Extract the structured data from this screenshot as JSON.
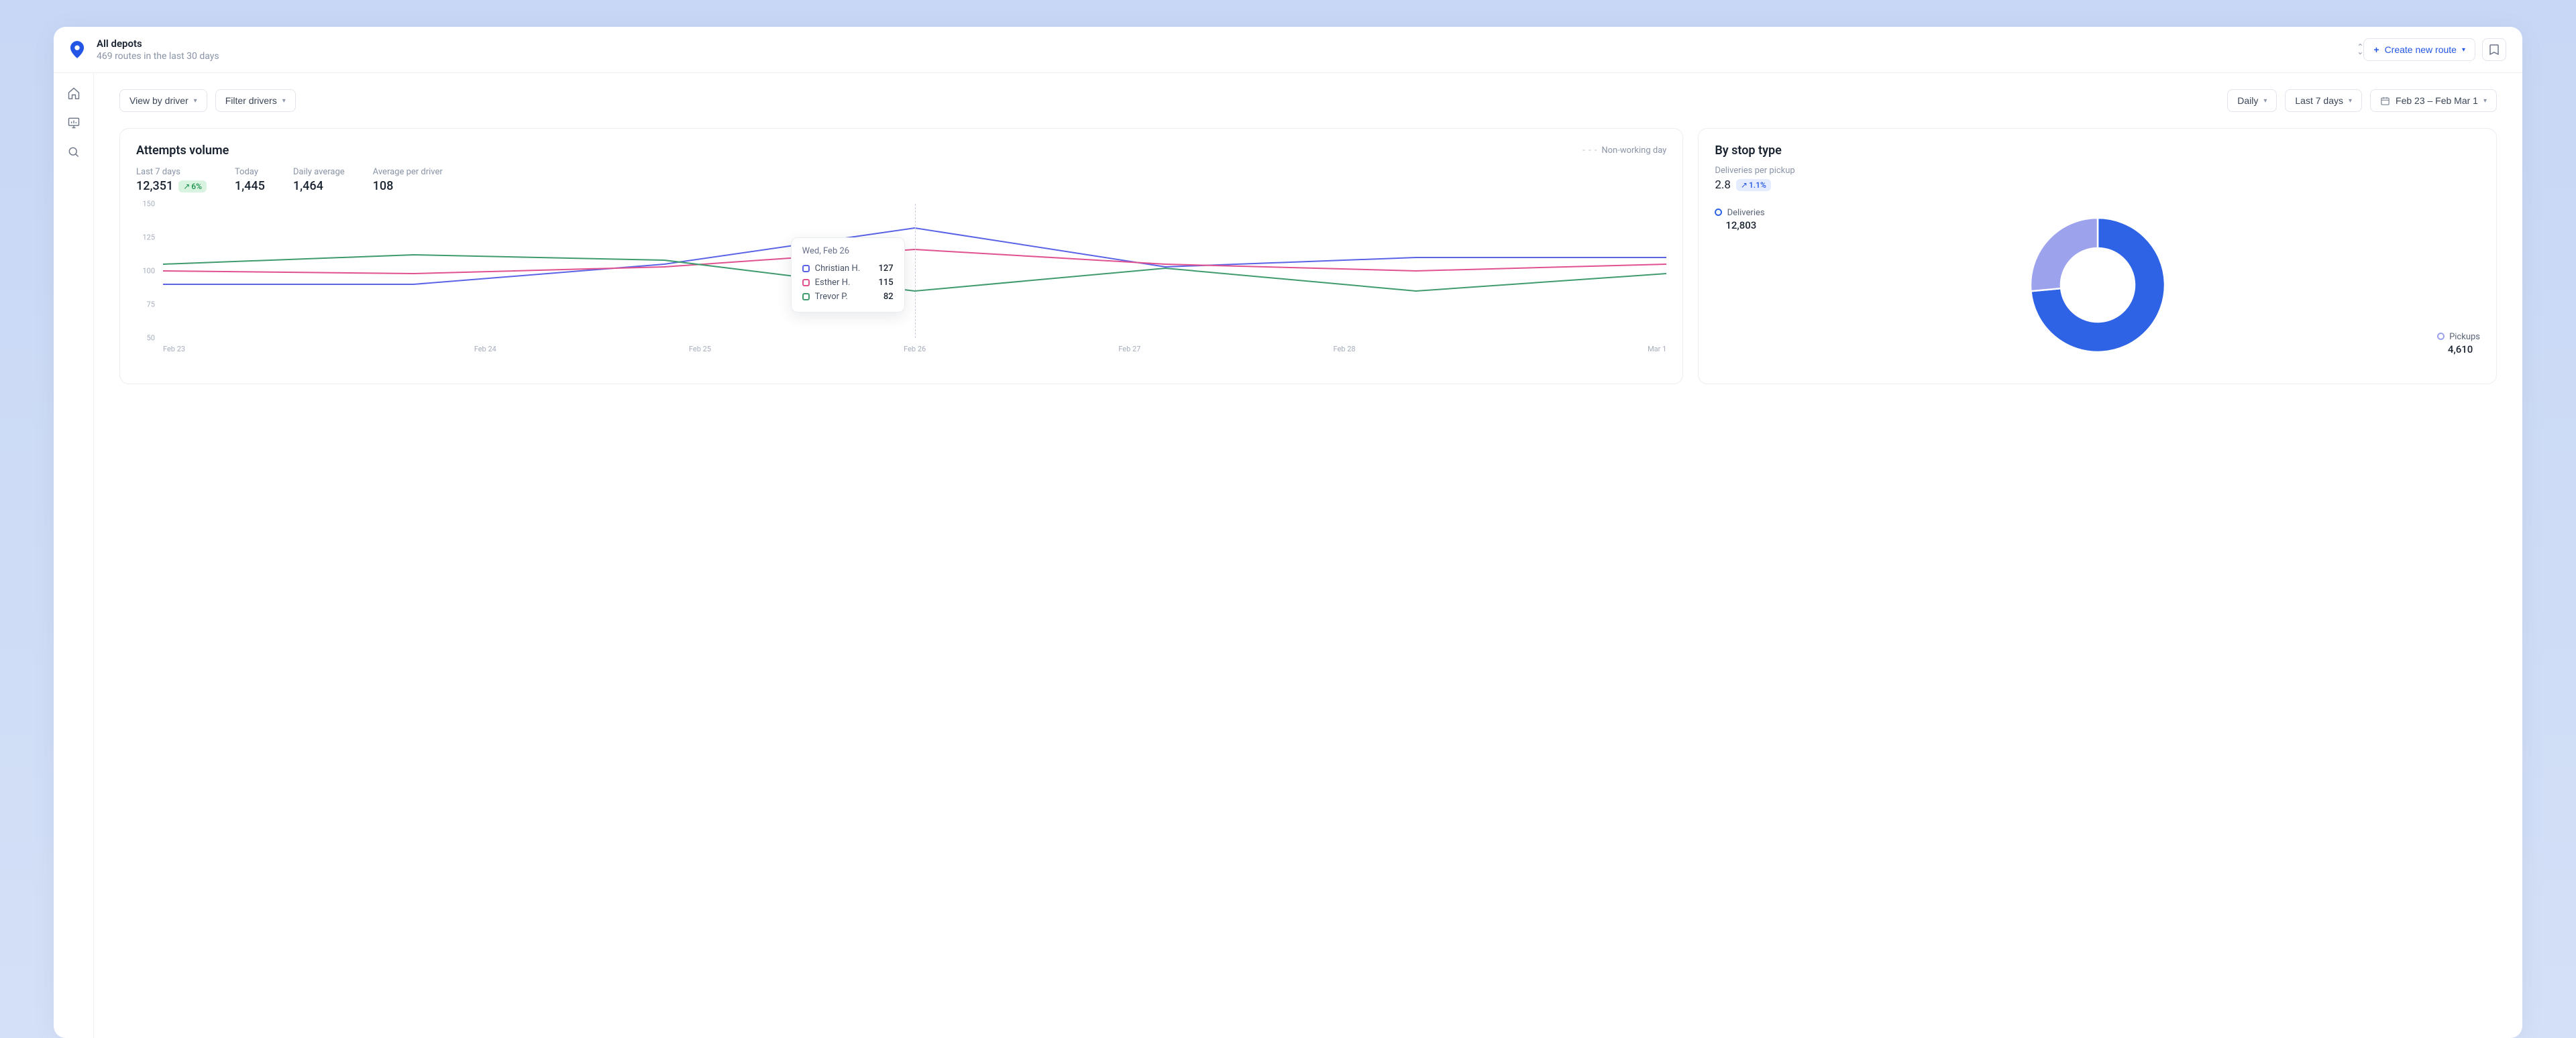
{
  "header": {
    "depot_title": "All depots",
    "depot_subtitle": "469 routes in the last 30 days",
    "create_route_label": "Create new route"
  },
  "toolbar": {
    "view_by": "View by driver",
    "filter": "Filter drivers",
    "granularity": "Daily",
    "range_preset": "Last 7 days",
    "range_dates": "Feb 23 – Feb Mar 1"
  },
  "attempts_card": {
    "title": "Attempts volume",
    "legend_nonworking": "Non-working day",
    "stats": {
      "period_label": "Last 7 days",
      "period_value": "12,351",
      "period_delta": "6%",
      "today_label": "Today",
      "today_value": "1,445",
      "avg_label": "Daily average",
      "avg_value": "1,464",
      "per_driver_label": "Average per driver",
      "per_driver_value": "108"
    },
    "tooltip": {
      "title": "Wed, Feb 26",
      "rows": [
        {
          "name": "Christian H.",
          "value": "127"
        },
        {
          "name": "Esther H.",
          "value": "115"
        },
        {
          "name": "Trevor P.",
          "value": "82"
        }
      ]
    }
  },
  "stop_type_card": {
    "title": "By stop type",
    "sub_label": "Deliveries per pickup",
    "sub_value": "2.8",
    "sub_delta": "1.1%",
    "deliveries_label": "Deliveries",
    "deliveries_value": "12,803",
    "pickups_label": "Pickups",
    "pickups_value": "4,610"
  },
  "chart_data": [
    {
      "type": "line",
      "title": "Attempts volume",
      "xlabel": "",
      "ylabel": "",
      "ylim": [
        50,
        150
      ],
      "y_ticks": [
        50,
        75,
        100,
        125,
        150
      ],
      "categories": [
        "Feb 23",
        "Feb 24",
        "Feb 25",
        "Feb 26",
        "Feb 27",
        "Feb 28",
        "Mar 1"
      ],
      "series": [
        {
          "name": "Christian H.",
          "color": "#5b63e6",
          "values": [
            90,
            90,
            105,
            132,
            103,
            110,
            110
          ]
        },
        {
          "name": "Esther H.",
          "color": "#e0528f",
          "values": [
            100,
            98,
            103,
            116,
            105,
            100,
            105
          ]
        },
        {
          "name": "Trevor P.",
          "color": "#3f9a6e",
          "values": [
            105,
            112,
            108,
            85,
            102,
            85,
            98
          ]
        }
      ],
      "hover_index": 3
    },
    {
      "type": "pie",
      "title": "By stop type",
      "series": [
        {
          "name": "Deliveries",
          "value": 12803,
          "color": "#2f63e6"
        },
        {
          "name": "Pickups",
          "value": 4610,
          "color": "#9da2ec"
        }
      ]
    }
  ]
}
